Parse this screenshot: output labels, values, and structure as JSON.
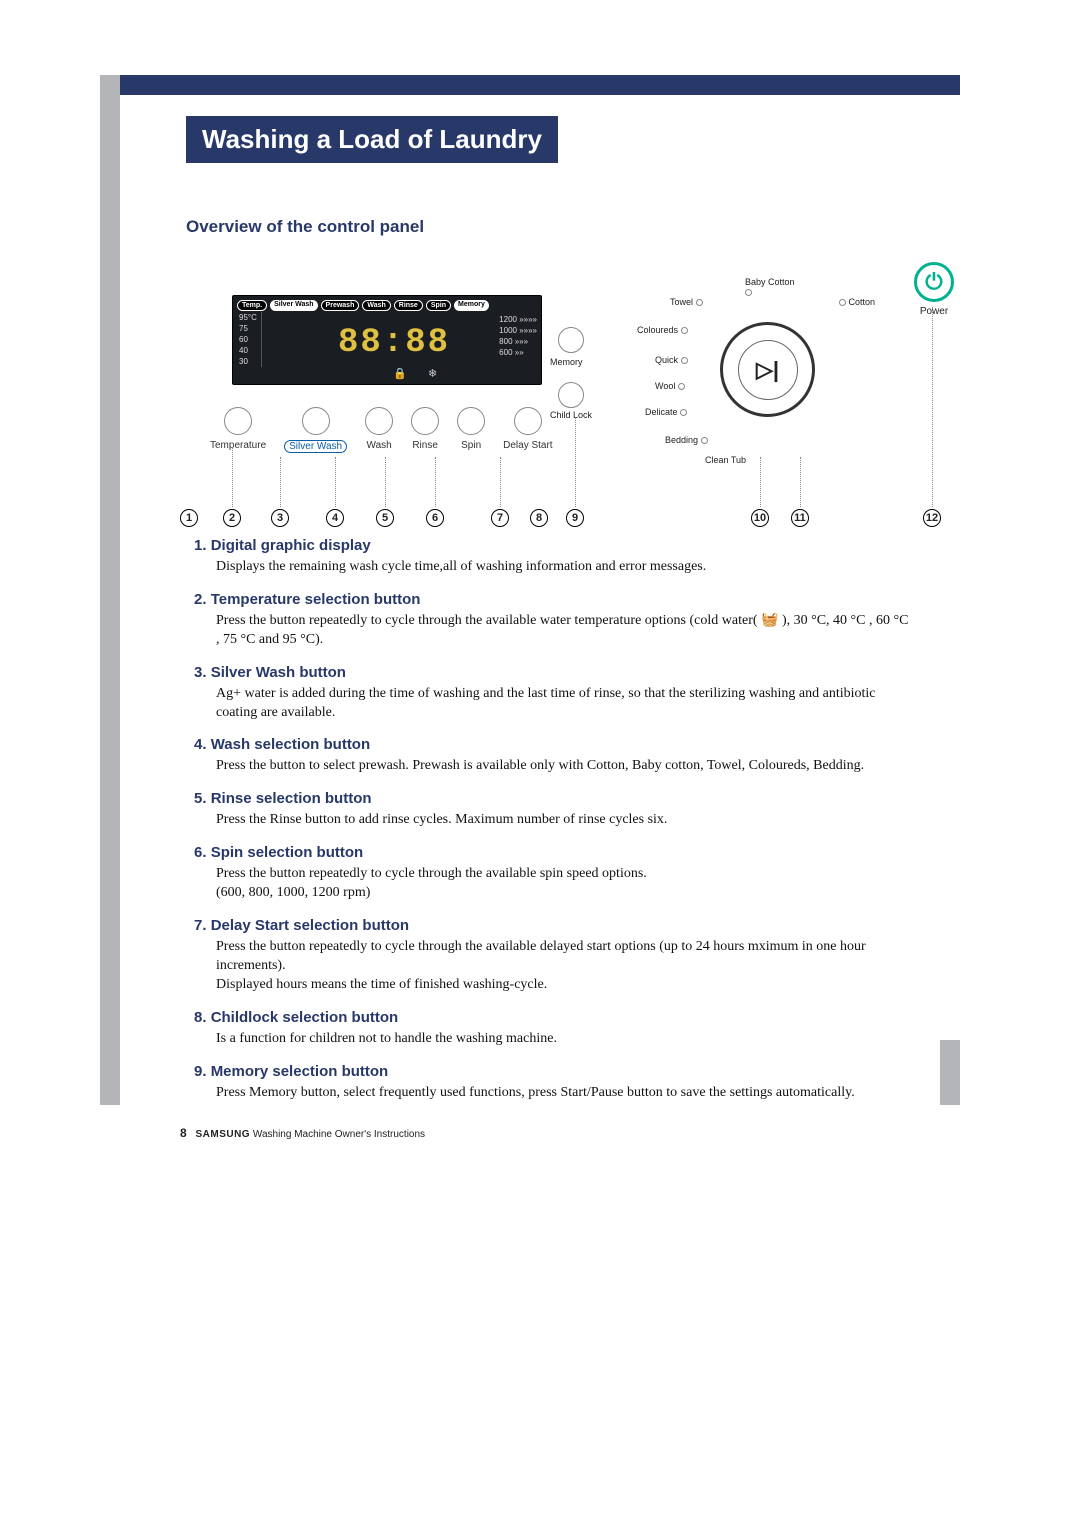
{
  "page_title": "Washing a Load of Laundry",
  "section_heading": "Overview of the control panel",
  "panel": {
    "pills": {
      "temp": "Temp.",
      "silverwash": "Silver Wash",
      "prewash": "Prewash",
      "wash": "Wash",
      "rinse": "Rinse",
      "spin": "Spin",
      "memory": "Memory"
    },
    "temp_levels": [
      "95°C",
      "75",
      "60",
      "40",
      "30"
    ],
    "seg_display": "88:88",
    "spin_levels": [
      "1200 »»»»",
      "1000 »»»»",
      "800 »»»",
      "600 »»"
    ],
    "buttons": [
      {
        "label": "Temperature",
        "highlight": false
      },
      {
        "label": "Silver Wash",
        "highlight": true
      },
      {
        "label": "Wash",
        "highlight": false
      },
      {
        "label": "Rinse",
        "highlight": false
      },
      {
        "label": "Spin",
        "highlight": false
      },
      {
        "label": "Delay Start",
        "highlight": false
      }
    ],
    "memory_label": "Memory",
    "childlock_label": "Child Lock",
    "dial_programs": [
      "Cotton",
      "Baby Cotton",
      "Towel",
      "Coloureds",
      "Quick",
      "Wool",
      "Delicate",
      "Bedding",
      "Clean Tub"
    ],
    "dial_center": "▷|",
    "power_label": "Power"
  },
  "callouts": [
    "1",
    "2",
    "3",
    "4",
    "5",
    "6",
    "7",
    "8",
    "9",
    "10",
    "11",
    "12"
  ],
  "items": [
    {
      "num": "1.",
      "title": "Digital graphic display",
      "body": "Displays the remaining wash cycle time,all of washing information and error messages."
    },
    {
      "num": "2.",
      "title": "Temperature selection button",
      "body": "Press the button  repeatedly to cycle through the available water temperature options (cold water( 🧺 ),  30 °C,  40 °C , 60 °C , 75 °C and 95 °C)."
    },
    {
      "num": "3.",
      "title": "Silver Wash button",
      "body": "Ag+ water is added during the time of washing and the last time of rinse, so that the sterilizing washing and antibiotic coating are available."
    },
    {
      "num": "4.",
      "title": "Wash selection button",
      "body": "Press the button to select prewash. Prewash is available only with Cotton, Baby cotton, Towel, Coloureds, Bedding."
    },
    {
      "num": "5.",
      "title": "Rinse selection button",
      "body": "Press the Rinse button to add rinse cycles. Maximum number of rinse cycles six."
    },
    {
      "num": "6.",
      "title": "Spin selection button",
      "body": "Press the button repeatedly to cycle through the available spin speed options.\n(600, 800, 1000, 1200 rpm)"
    },
    {
      "num": "7.",
      "title": "Delay Start selection button",
      "body": "Press the button repeatedly to cycle through the available delayed start options (up to 24 hours mximum in one hour increments).\nDisplayed hours means the time of finished washing-cycle."
    },
    {
      "num": "8.",
      "title": "Childlock selection button",
      "body": "Is a function for children not to handle the washing machine."
    },
    {
      "num": "9.",
      "title": "Memory selection button",
      "body": "Press Memory button, select frequently used functions, press Start/Pause button to save the settings automatically."
    }
  ],
  "footer": {
    "page_no": "8",
    "brand": "SAMSUNG",
    "tail": "Washing Machine Owner's Instructions"
  }
}
